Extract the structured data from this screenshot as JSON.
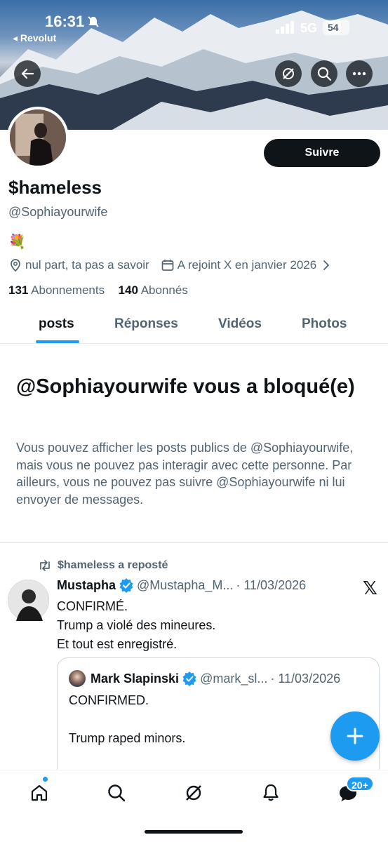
{
  "status_bar": {
    "time": "16:31",
    "back_app": "◂ Revolut",
    "network": "5G",
    "battery": "54"
  },
  "profile": {
    "display_name": "$hameless",
    "handle": "@Sophiayourwife",
    "bio_emoji": "💐",
    "location": "nul part, ta pas a savoir",
    "joined": "A rejoint X en janvier 2026",
    "following_count": "131",
    "following_label": "Abonnements",
    "followers_count": "140",
    "followers_label": "Abonnés",
    "follow_button": "Suivre"
  },
  "tabs": [
    {
      "label": "posts",
      "active": true
    },
    {
      "label": "Réponses",
      "active": false
    },
    {
      "label": "Vidéos",
      "active": false
    },
    {
      "label": "Photos",
      "active": false
    }
  ],
  "blocked": {
    "title": "@Sophiayourwife vous a bloqué(e)",
    "text": "Vous pouvez afficher les posts publics de @Sophiayourwife, mais vous ne pouvez pas interagir avec cette personne. Par ailleurs, vous ne pouvez pas suivre @Sophiayourwife ni lui envoyer de messages."
  },
  "post": {
    "repost_label": "$hameless a reposté",
    "author_name": "Mustapha",
    "author_handle": "@Mustapha_M...",
    "date": "· 11/03/2026",
    "lines": [
      "CONFIRMÉ.",
      "Trump a violé des mineures.",
      "Et tout est enregistré."
    ],
    "quote": {
      "author_name": "Mark Slapinski",
      "author_handle": "@mark_sl...",
      "date": "· 11/03/2026",
      "lines": [
        "CONFIRMED.",
        "Trump raped minors."
      ]
    }
  },
  "bottom_nav": {
    "messages_badge": "20+"
  },
  "colors": {
    "accent": "#1d9bf0",
    "text": "#0f1419",
    "secondary": "#536471"
  }
}
